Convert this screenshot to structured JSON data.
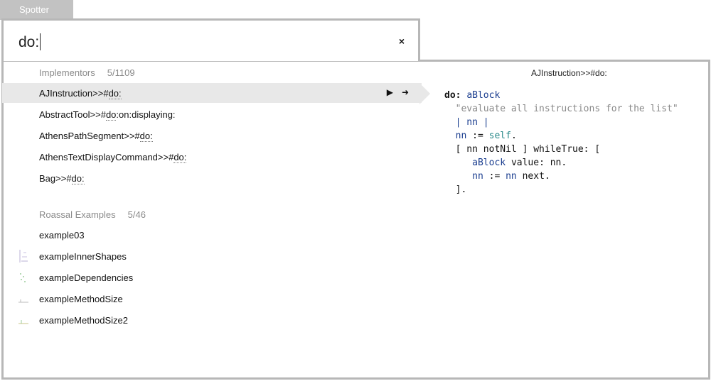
{
  "window": {
    "tab_label": "Spotter"
  },
  "search": {
    "query": "do:"
  },
  "categories": [
    {
      "name": "Implementors",
      "count": "5/1109",
      "items": [
        {
          "prefix": "AJInstruction>>#",
          "match": "do:",
          "suffix": ""
        },
        {
          "prefix": "AbstractTool>>#",
          "match": "do",
          "suffix": ":on:displaying:"
        },
        {
          "prefix": "AthensPathSegment>>#",
          "match": "do:",
          "suffix": ""
        },
        {
          "prefix": "AthensTextDisplayCommand>>#",
          "match": "do:",
          "suffix": ""
        },
        {
          "prefix": "Bag>>#",
          "match": "do:",
          "suffix": ""
        }
      ]
    },
    {
      "name": "Roassal Examples",
      "count": "5/46",
      "items": [
        {
          "label": "example03"
        },
        {
          "label": "exampleInnerShapes"
        },
        {
          "label": "exampleDependencies"
        },
        {
          "label": "exampleMethodSize"
        },
        {
          "label": "exampleMethodSize2"
        }
      ]
    }
  ],
  "preview": {
    "title": "AJInstruction>>#do:",
    "code": {
      "selector": "do:",
      "arg": "aBlock",
      "comment": "\"evaluate all instructions for the list\"",
      "temps": "| nn |",
      "assign_var": "nn",
      "assign_op": ":=",
      "self_kw": "self",
      "loop_open": "[ nn notNil ] whileTrue: [",
      "line_value_block": "aBlock",
      "line_value_rest": "value: nn.",
      "line_next_var": "nn",
      "line_next_op": ":=",
      "line_next_var2": "nn",
      "line_next_rest": "next.",
      "close": "]."
    }
  },
  "icons": {
    "play": "play-icon",
    "go": "arrow-right-icon",
    "clear": "close-icon"
  }
}
